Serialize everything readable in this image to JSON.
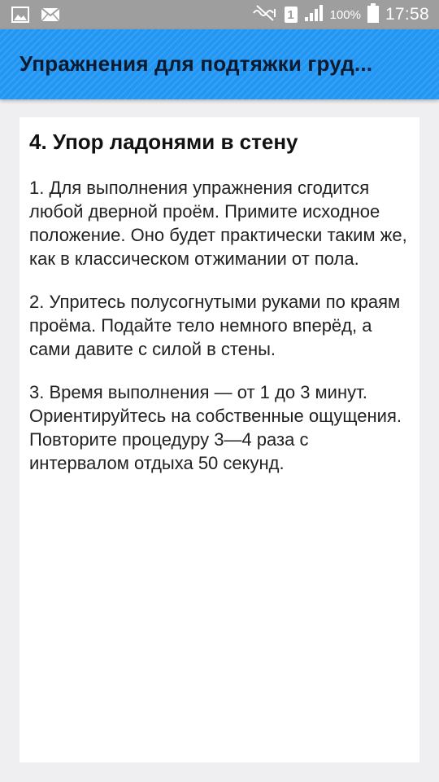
{
  "status_bar": {
    "icons_left": [
      "image-icon",
      "mail-icon"
    ],
    "icons_right": [
      "mute-icon",
      "sim-icon",
      "signal-icon",
      "battery-icon"
    ],
    "sim_number": "1",
    "battery": "100%",
    "time": "17:58"
  },
  "app_bar": {
    "title": "Упражнения для подтяжки груд...",
    "color": "#2196f3"
  },
  "content": {
    "title": "4. Упор ладонями в стену",
    "steps": [
      "1. Для выполнения упражнения сгодится любой дверной проём. Примите исходное положение. Оно будет практически таким же, как в классическом отжимании от пола.",
      "2. Упритесь полусогнутыми руками по краям проёма. Подайте тело немного вперёд, а сами давите с силой в стены.",
      "3. Время выполнения — от 1 до 3 минут. Ориентируйтесь на собственные ощущения. Повторите процедуру 3—4 раза с интервалом отдыха 50 секунд."
    ]
  }
}
